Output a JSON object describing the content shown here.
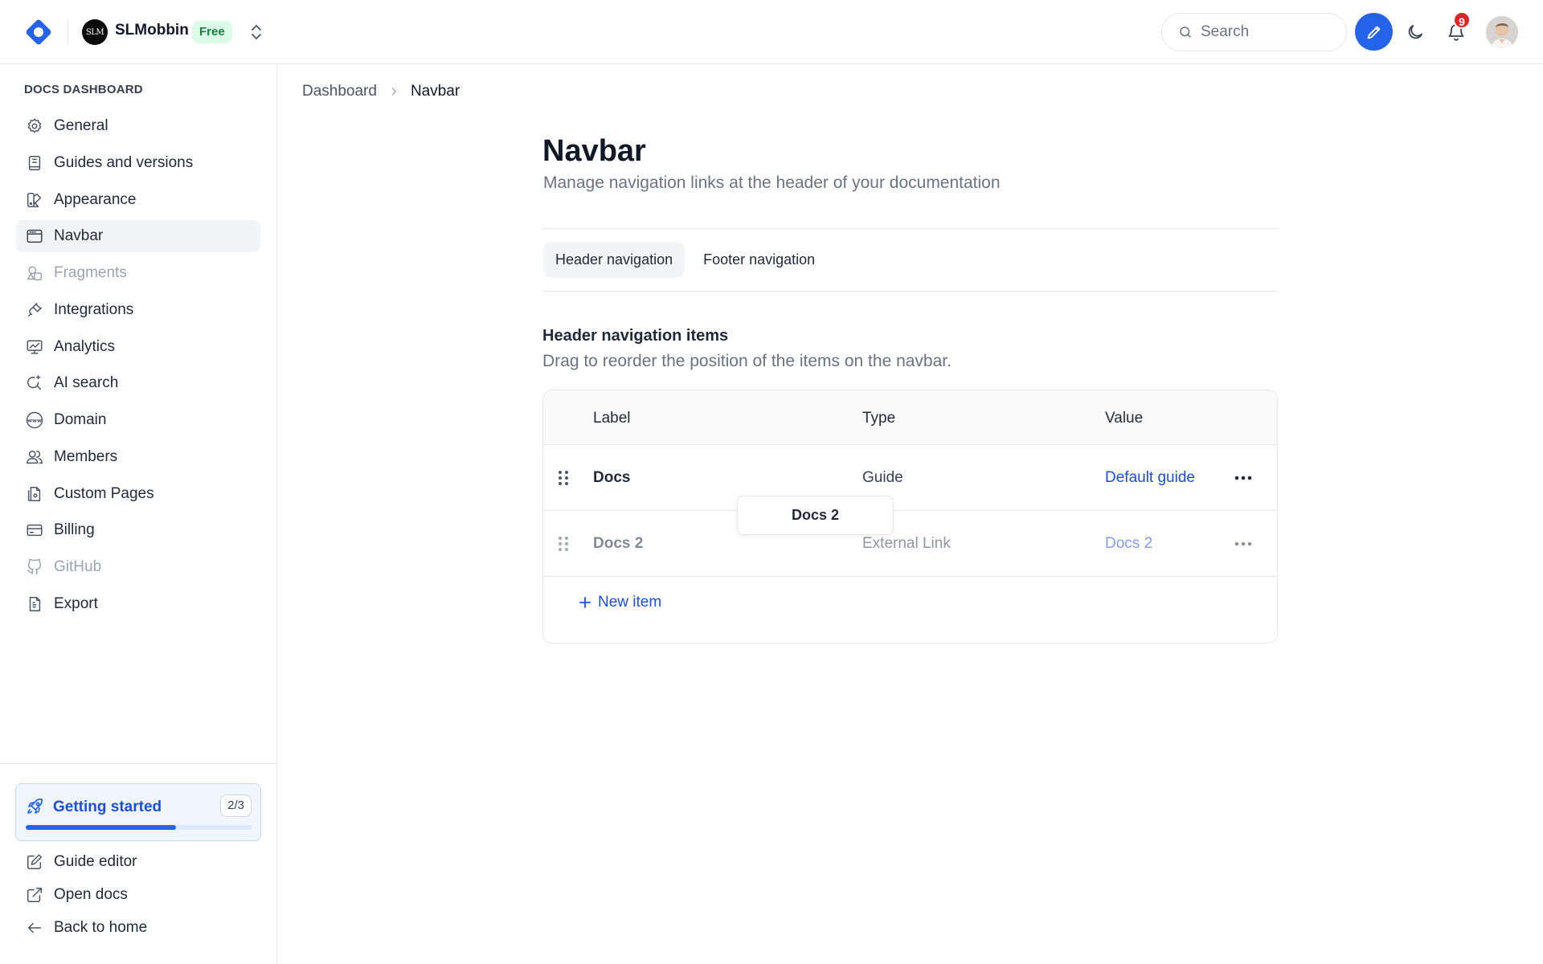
{
  "header": {
    "workspace_avatar_text": "SLM",
    "workspace_name": "SLMobbin",
    "plan_badge": "Free",
    "search_placeholder": "Search",
    "notifications_count": "9"
  },
  "sidebar": {
    "heading": "DOCS DASHBOARD",
    "items": [
      {
        "label": "General",
        "icon": "gear-icon",
        "state": "normal"
      },
      {
        "label": "Guides and versions",
        "icon": "book-icon",
        "state": "normal"
      },
      {
        "label": "Appearance",
        "icon": "palette-icon",
        "state": "normal"
      },
      {
        "label": "Navbar",
        "icon": "browser-window-icon",
        "state": "active"
      },
      {
        "label": "Fragments",
        "icon": "shapes-icon",
        "state": "disabled"
      },
      {
        "label": "Integrations",
        "icon": "plug-icon",
        "state": "normal"
      },
      {
        "label": "Analytics",
        "icon": "chart-monitor-icon",
        "state": "normal"
      },
      {
        "label": "AI search",
        "icon": "ai-search-icon",
        "state": "normal"
      },
      {
        "label": "Domain",
        "icon": "globe-www-icon",
        "state": "normal"
      },
      {
        "label": "Members",
        "icon": "users-icon",
        "state": "normal"
      },
      {
        "label": "Custom Pages",
        "icon": "pages-icon",
        "state": "normal"
      },
      {
        "label": "Billing",
        "icon": "credit-card-icon",
        "state": "normal"
      },
      {
        "label": "GitHub",
        "icon": "github-icon",
        "state": "disabled"
      },
      {
        "label": "Export",
        "icon": "export-file-icon",
        "state": "normal"
      }
    ],
    "getting_started": {
      "label": "Getting started",
      "count": "2/3",
      "progress": 0.667
    },
    "footer_items": [
      {
        "label": "Guide editor",
        "icon": "edit-square-icon"
      },
      {
        "label": "Open docs",
        "icon": "external-link-icon"
      },
      {
        "label": "Back to home",
        "icon": "arrow-left-icon"
      }
    ]
  },
  "breadcrumb": {
    "root": "Dashboard",
    "current": "Navbar"
  },
  "page": {
    "title": "Navbar",
    "subtitle": "Manage navigation links at the header of your documentation"
  },
  "tabs": [
    {
      "label": "Header navigation",
      "active": true
    },
    {
      "label": "Footer navigation",
      "active": false
    }
  ],
  "section": {
    "title": "Header navigation items",
    "subtitle": "Drag to reorder the position of the items on the navbar."
  },
  "table": {
    "columns": [
      "Label",
      "Type",
      "Value"
    ],
    "rows": [
      {
        "label": "Docs",
        "type": "Guide",
        "value": "Default guide"
      },
      {
        "label": "Docs 2",
        "type": "External Link",
        "value": "Docs 2"
      }
    ],
    "new_item_label": "New item"
  },
  "drag_ghost": {
    "label": "Docs 2"
  },
  "colors": {
    "accent": "#2563eb",
    "badge_bg": "#dcfce7",
    "badge_text": "#15803d",
    "danger": "#dc2626"
  }
}
